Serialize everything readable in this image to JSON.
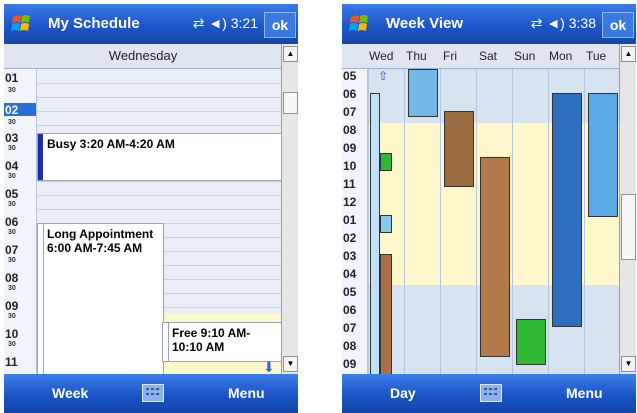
{
  "left": {
    "title": "My Schedule",
    "time": "3:21",
    "ok": "ok",
    "day": "Wednesday",
    "hours": [
      "01",
      "02",
      "03",
      "04",
      "05",
      "06",
      "07",
      "08",
      "09",
      "10",
      "11"
    ],
    "half": "30",
    "appointments": [
      {
        "text": "Busy 3:20 AM-4:20 AM",
        "color": "#1f2fa8"
      },
      {
        "text": "Long Appointment 6:00 AM-7:45 AM",
        "color": "#ffffff"
      },
      {
        "text": "Free 9:10 AM-10:10 AM",
        "color": "#ffffff"
      }
    ],
    "softkeys": {
      "left": "Week",
      "right": "Menu"
    }
  },
  "right": {
    "title": "Week View",
    "time": "3:38",
    "ok": "ok",
    "days": [
      "Wed",
      "Thu",
      "Fri",
      "Sat",
      "Sun",
      "Mon",
      "Tue"
    ],
    "hours": [
      "05",
      "06",
      "07",
      "08",
      "09",
      "10",
      "11",
      "12",
      "01",
      "02",
      "03",
      "04",
      "05",
      "06",
      "07",
      "08",
      "09"
    ],
    "softkeys": {
      "left": "Day",
      "right": "Menu"
    }
  },
  "colors": {
    "accent": "#1d56c9",
    "busy": "#1f2fa8",
    "light_blue": "#74b8e8",
    "brown": "#9a6b3f",
    "green": "#28b82c",
    "dark_blue": "#2f6fbf",
    "free_yellow": "#fff7cc"
  }
}
